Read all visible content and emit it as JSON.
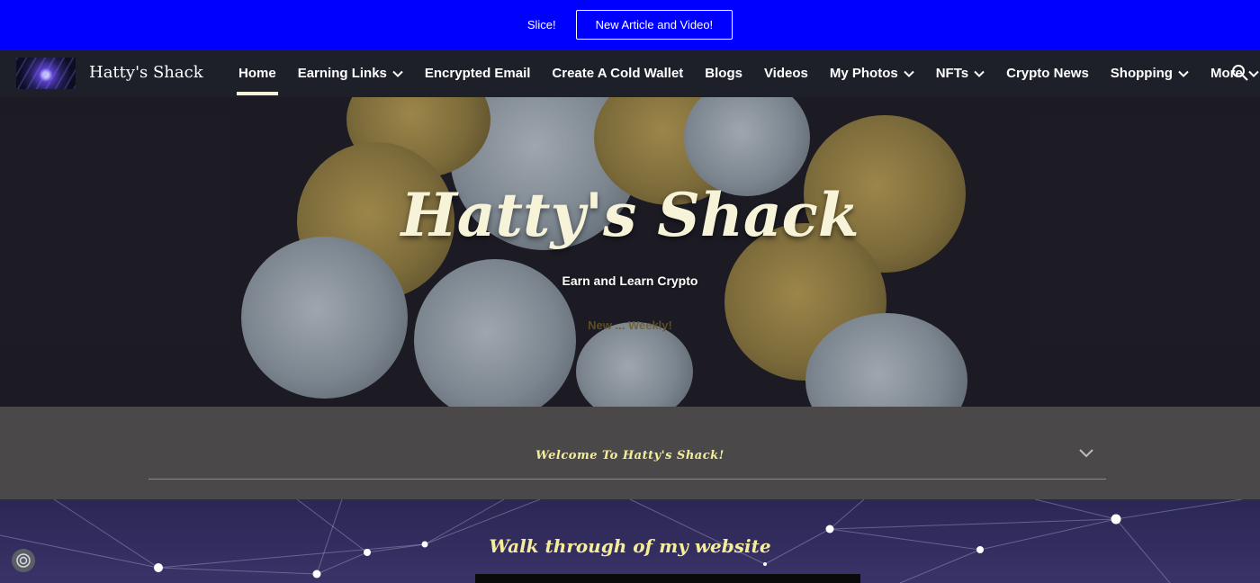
{
  "announcement": {
    "text": "Slice!",
    "button_label": "New Article and Video!"
  },
  "header": {
    "site_title": "Hatty's Shack"
  },
  "nav": {
    "items": [
      {
        "label": "Home",
        "active": true,
        "dropdown": false
      },
      {
        "label": "Earning Links",
        "active": false,
        "dropdown": true
      },
      {
        "label": "Encrypted Email",
        "active": false,
        "dropdown": false
      },
      {
        "label": "Create A Cold Wallet",
        "active": false,
        "dropdown": false
      },
      {
        "label": "Blogs",
        "active": false,
        "dropdown": false
      },
      {
        "label": "Videos",
        "active": false,
        "dropdown": false
      },
      {
        "label": "My Photos",
        "active": false,
        "dropdown": true
      },
      {
        "label": "NFTs",
        "active": false,
        "dropdown": true
      },
      {
        "label": "Crypto News",
        "active": false,
        "dropdown": false
      },
      {
        "label": "Shopping",
        "active": false,
        "dropdown": true
      },
      {
        "label": "More",
        "active": false,
        "dropdown": true
      }
    ],
    "search_icon": "search-icon"
  },
  "hero": {
    "title": "Hatty's Shack",
    "subtitle": "Earn and Learn Crypto",
    "faded_text": "New ... Weekly!"
  },
  "welcome": {
    "title": "Welcome To Hatty's Shack!",
    "icon": "chevron-down-icon"
  },
  "walkthrough": {
    "title": "Walk through of my website"
  },
  "colors": {
    "announcement_bg": "#0000ff",
    "nav_bg": "#1d2029",
    "accent_text": "#f4ee9a",
    "welcome_bg": "#4a4848"
  }
}
